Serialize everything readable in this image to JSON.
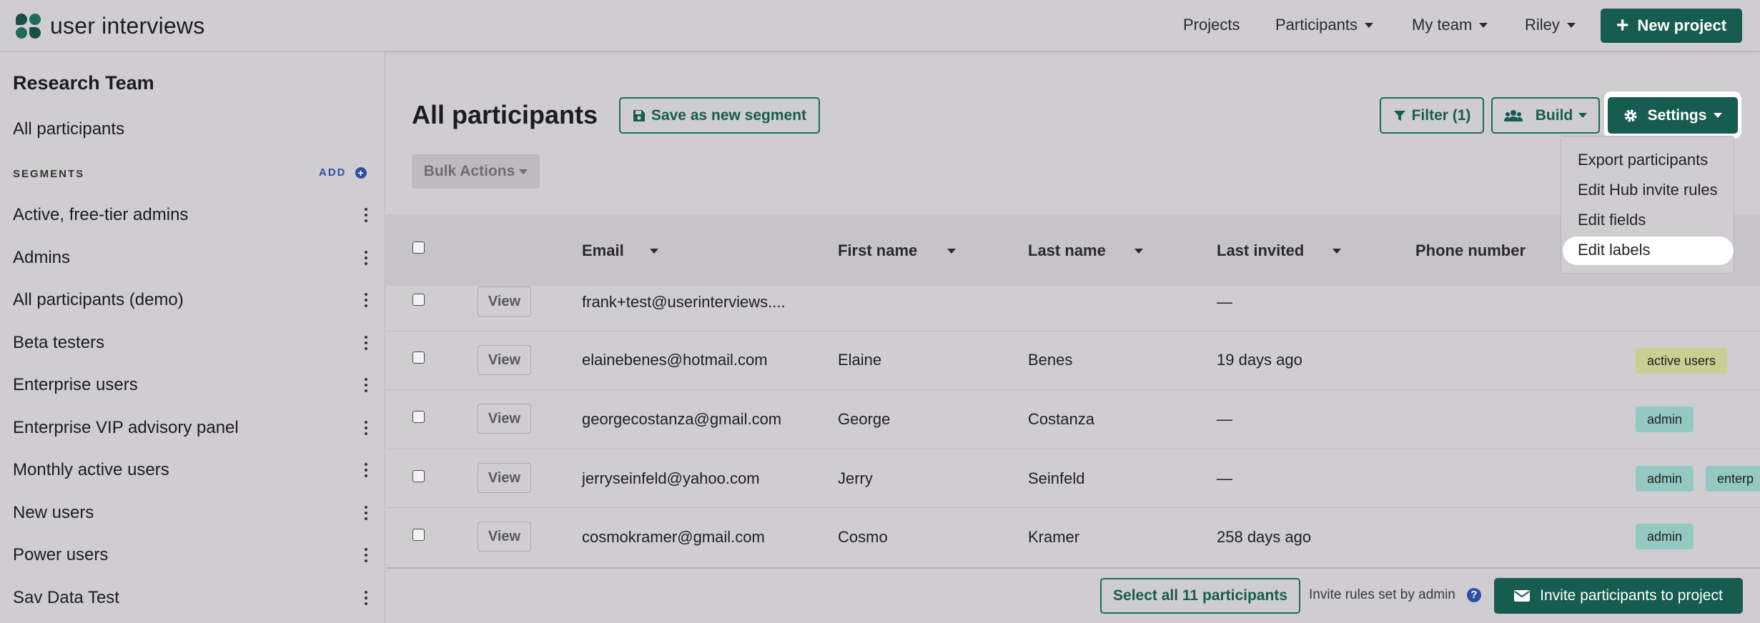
{
  "brand": {
    "name": "user interviews"
  },
  "topnav": {
    "items": [
      {
        "label": "Projects",
        "dropdown": false
      },
      {
        "label": "Participants",
        "dropdown": true
      },
      {
        "label": "My team",
        "dropdown": true
      },
      {
        "label": "Riley",
        "dropdown": true
      }
    ],
    "new_project_label": "New project"
  },
  "sidebar": {
    "team": "Research Team",
    "all_participants": "All participants",
    "segments_heading": "SEGMENTS",
    "add_label": "ADD",
    "segments": [
      "Active, free-tier admins",
      "Admins",
      "All participants (demo)",
      "Beta testers",
      "Enterprise users",
      "Enterprise VIP advisory panel",
      "Monthly active users",
      "New users",
      "Power users",
      "Sav Data Test"
    ]
  },
  "main": {
    "title": "All participants",
    "save_segment_label": "Save as new segment",
    "filter_label": "Filter (1)",
    "build_label": "Build",
    "settings_label": "Settings",
    "bulk_actions_label": "Bulk Actions",
    "settings_menu": [
      "Export participants",
      "Edit Hub invite rules",
      "Edit fields",
      "Edit labels"
    ],
    "settings_menu_highlighted": "Edit labels"
  },
  "table": {
    "columns": [
      "Email",
      "First name",
      "Last name",
      "Last invited",
      "Phone number"
    ],
    "view_label": "View",
    "rows": [
      {
        "email": "frank+test@userinterviews....",
        "first": "",
        "last": "",
        "invited": "—",
        "labels": []
      },
      {
        "email": "elainebenes@hotmail.com",
        "first": "Elaine",
        "last": "Benes",
        "invited": "19 days ago",
        "labels": [
          "active users"
        ]
      },
      {
        "email": "georgecostanza@gmail.com",
        "first": "George",
        "last": "Costanza",
        "invited": "—",
        "labels": [
          "admin"
        ]
      },
      {
        "email": "jerryseinfeld@yahoo.com",
        "first": "Jerry",
        "last": "Seinfeld",
        "invited": "—",
        "labels": [
          "admin",
          "enterp"
        ]
      },
      {
        "email": "cosmokramer@gmail.com",
        "first": "Cosmo",
        "last": "Kramer",
        "invited": "258 days ago",
        "labels": [
          "admin"
        ]
      }
    ]
  },
  "footer": {
    "select_all_label": "Select all 11 participants",
    "invite_rules_text": "Invite rules set by admin",
    "invite_button_label": "Invite participants to project"
  },
  "colors": {
    "primary": "#175c50",
    "background": "#cfcdd0",
    "link_blue": "#2e4fa8",
    "label_teal": "#94c9c3",
    "label_olive": "#c9cf93"
  }
}
